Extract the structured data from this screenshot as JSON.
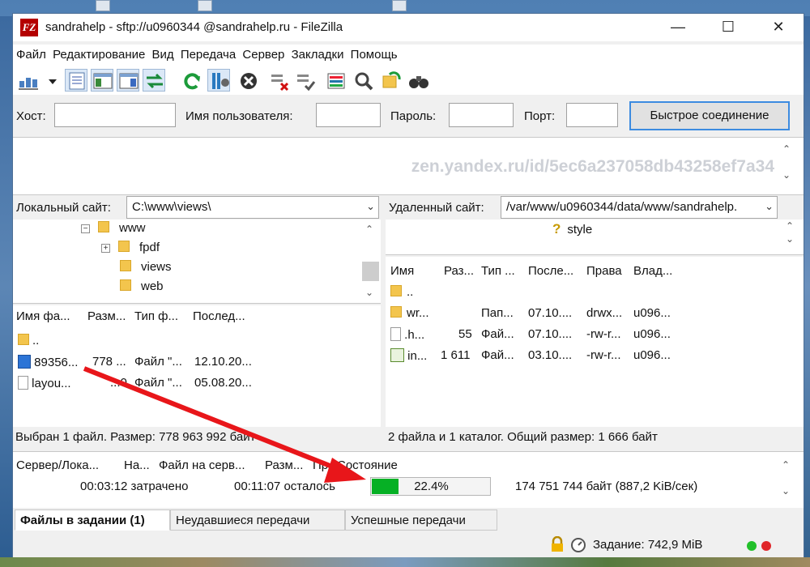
{
  "window": {
    "title": "sandrahelp - sftp://u0960344 @sandrahelp.ru - FileZilla",
    "logo_text": "FZ"
  },
  "window_buttons": {
    "minimize": "—",
    "maximize": "☐",
    "close": "✕"
  },
  "menu": [
    "Файл",
    "Редактирование",
    "Вид",
    "Передача",
    "Сервер",
    "Закладки",
    "Помощь"
  ],
  "toolbar": {
    "icons": [
      "site-manager-icon",
      "dropdown-icon",
      "toggle-log-icon",
      "toggle-local-tree-icon",
      "toggle-remote-tree-icon",
      "toggle-queue-icon",
      "refresh-icon",
      "process-queue-icon",
      "cancel-icon",
      "disconnect-icon",
      "reconnect-icon",
      "directory-listing-filters-icon",
      "compare-icon",
      "sync-browse-icon",
      "search-icon"
    ]
  },
  "quickconnect": {
    "host_label": "Хост:",
    "user_label": "Имя пользователя:",
    "pass_label": "Пароль:",
    "port_label": "Порт:",
    "host_value": "",
    "user_value": "",
    "pass_value": "",
    "port_value": "",
    "button": "Быстрое соединение"
  },
  "message_log": {
    "watermark": "zen.yandex.ru/id/5ec6a237058db43258ef7a34"
  },
  "local": {
    "site_label": "Локальный сайт:",
    "path": "C:\\www\\views\\",
    "tree": [
      {
        "name": "www",
        "expander": "−"
      },
      {
        "name": "fpdf",
        "expander": "+"
      },
      {
        "name": "views",
        "expander": ""
      },
      {
        "name": "web",
        "expander": ""
      }
    ],
    "columns": [
      "Имя фа...",
      "Разм...",
      "Тип ф...",
      "Послед..."
    ],
    "rows": [
      {
        "name": "..",
        "size": "",
        "type": "",
        "date": ""
      },
      {
        "name": "89356...",
        "size": "778 ...",
        "type": "Файл \"...",
        "date": "12.10.20..."
      },
      {
        "name": "layou...",
        "size": "...0",
        "type": "Файл \"...",
        "date": "05.08.20..."
      }
    ],
    "status": "Выбран 1 файл. Размер: 778 963 992 байт"
  },
  "remote": {
    "site_label": "Удаленный сайт:",
    "path": "/var/www/u0960344/data/www/sandrahelp.",
    "tree": [
      {
        "name": "style",
        "icon": "?"
      }
    ],
    "columns": [
      "Имя",
      "Раз...",
      "Тип ...",
      "После...",
      "Права",
      "Влад..."
    ],
    "rows": [
      {
        "name": "..",
        "size": "",
        "type": "",
        "date": "",
        "perm": "",
        "owner": ""
      },
      {
        "name": "wr...",
        "size": "",
        "type": "Пап...",
        "date": "07.10....",
        "perm": "drwx...",
        "owner": "u096..."
      },
      {
        "name": ".h...",
        "size": "55",
        "type": "Фай...",
        "date": "07.10....",
        "perm": "-rw-r...",
        "owner": "u096..."
      },
      {
        "name": "in...",
        "size": "1 611",
        "type": "Фай...",
        "date": "03.10....",
        "perm": "-rw-r...",
        "owner": "u096..."
      }
    ],
    "status": "2 файла и 1 каталог. Общий размер: 1 666 байт"
  },
  "queue": {
    "columns": [
      "Сервер/Лока...",
      "На...",
      "Файл на серв...",
      "Разм...",
      "Пр...",
      "Состояние"
    ],
    "elapsed": "00:03:12 затрачено",
    "remaining": "00:11:07 осталось",
    "progress_percent": 22.4,
    "progress_text": "22.4%",
    "transferred": "174 751 744 байт (887,2 KiB/сек)"
  },
  "tabs": [
    "Файлы в задании (1)",
    "Неудавшиеся передачи",
    "Успешные передачи"
  ],
  "statusbar": {
    "queue_text": "Задание: 742,9 MiB"
  },
  "colors": {
    "progress_fill": "#06b025",
    "arrow": "#e8161a",
    "led_green": "#22c02a",
    "led_red": "#e0262a"
  }
}
